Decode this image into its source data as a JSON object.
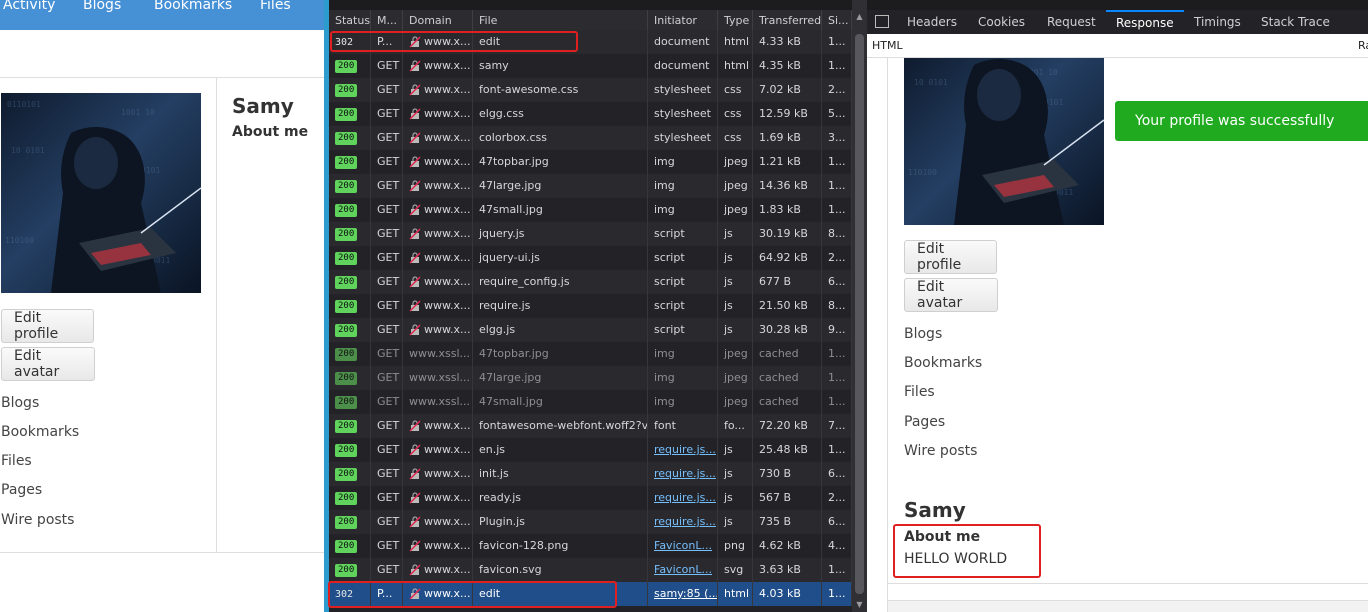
{
  "site": {
    "nav": [
      "Activity",
      "Blogs",
      "Bookmarks",
      "Files"
    ],
    "profile_name": "Samy",
    "about_label": "About me",
    "buttons": {
      "edit_profile": "Edit profile",
      "edit_avatar": "Edit avatar"
    },
    "links": [
      "Blogs",
      "Bookmarks",
      "Files",
      "Pages",
      "Wire posts"
    ]
  },
  "network": {
    "columns": [
      "Status",
      "M...",
      "Domain",
      "File",
      "Initiator",
      "Type",
      "Transferred",
      "Si..."
    ],
    "rows": [
      {
        "status": "302",
        "method": "P...",
        "domain": "www.x...",
        "file": "edit",
        "initiator": "document",
        "type": "html",
        "transferred": "4.33 kB",
        "size": "1...",
        "secure": true
      },
      {
        "status": "200",
        "method": "GET",
        "domain": "www.x...",
        "file": "samy",
        "initiator": "document",
        "type": "html",
        "transferred": "4.35 kB",
        "size": "1...",
        "secure": true
      },
      {
        "status": "200",
        "method": "GET",
        "domain": "www.x...",
        "file": "font-awesome.css",
        "initiator": "stylesheet",
        "type": "css",
        "transferred": "7.02 kB",
        "size": "2...",
        "secure": true
      },
      {
        "status": "200",
        "method": "GET",
        "domain": "www.x...",
        "file": "elgg.css",
        "initiator": "stylesheet",
        "type": "css",
        "transferred": "12.59 kB",
        "size": "5...",
        "secure": true
      },
      {
        "status": "200",
        "method": "GET",
        "domain": "www.x...",
        "file": "colorbox.css",
        "initiator": "stylesheet",
        "type": "css",
        "transferred": "1.69 kB",
        "size": "3...",
        "secure": true
      },
      {
        "status": "200",
        "method": "GET",
        "domain": "www.x...",
        "file": "47topbar.jpg",
        "initiator": "img",
        "type": "jpeg",
        "transferred": "1.21 kB",
        "size": "1...",
        "secure": true
      },
      {
        "status": "200",
        "method": "GET",
        "domain": "www.x...",
        "file": "47large.jpg",
        "initiator": "img",
        "type": "jpeg",
        "transferred": "14.36 kB",
        "size": "1...",
        "secure": true
      },
      {
        "status": "200",
        "method": "GET",
        "domain": "www.x...",
        "file": "47small.jpg",
        "initiator": "img",
        "type": "jpeg",
        "transferred": "1.83 kB",
        "size": "1...",
        "secure": true
      },
      {
        "status": "200",
        "method": "GET",
        "domain": "www.x...",
        "file": "jquery.js",
        "initiator": "script",
        "type": "js",
        "transferred": "30.19 kB",
        "size": "8...",
        "secure": true
      },
      {
        "status": "200",
        "method": "GET",
        "domain": "www.x...",
        "file": "jquery-ui.js",
        "initiator": "script",
        "type": "js",
        "transferred": "64.92 kB",
        "size": "2...",
        "secure": true
      },
      {
        "status": "200",
        "method": "GET",
        "domain": "www.x...",
        "file": "require_config.js",
        "initiator": "script",
        "type": "js",
        "transferred": "677 B",
        "size": "6...",
        "secure": true
      },
      {
        "status": "200",
        "method": "GET",
        "domain": "www.x...",
        "file": "require.js",
        "initiator": "script",
        "type": "js",
        "transferred": "21.50 kB",
        "size": "8...",
        "secure": true
      },
      {
        "status": "200",
        "method": "GET",
        "domain": "www.x...",
        "file": "elgg.js",
        "initiator": "script",
        "type": "js",
        "transferred": "30.28 kB",
        "size": "9...",
        "secure": true
      },
      {
        "status": "200",
        "method": "GET",
        "domain": "www.xssl...",
        "file": "47topbar.jpg",
        "initiator": "img",
        "type": "jpeg",
        "transferred": "cached",
        "size": "1...",
        "secure": false,
        "cached": true
      },
      {
        "status": "200",
        "method": "GET",
        "domain": "www.xssl...",
        "file": "47large.jpg",
        "initiator": "img",
        "type": "jpeg",
        "transferred": "cached",
        "size": "1...",
        "secure": false,
        "cached": true
      },
      {
        "status": "200",
        "method": "GET",
        "domain": "www.xssl...",
        "file": "47small.jpg",
        "initiator": "img",
        "type": "jpeg",
        "transferred": "cached",
        "size": "1...",
        "secure": false,
        "cached": true
      },
      {
        "status": "200",
        "method": "GET",
        "domain": "www.x...",
        "file": "fontawesome-webfont.woff2?v=",
        "initiator": "font",
        "type": "fo...",
        "transferred": "72.20 kB",
        "size": "7...",
        "secure": true
      },
      {
        "status": "200",
        "method": "GET",
        "domain": "www.x...",
        "file": "en.js",
        "initiator": "require.js...",
        "type": "js",
        "transferred": "25.48 kB",
        "size": "1...",
        "secure": true,
        "initiator_link": true
      },
      {
        "status": "200",
        "method": "GET",
        "domain": "www.x...",
        "file": "init.js",
        "initiator": "require.js...",
        "type": "js",
        "transferred": "730 B",
        "size": "6...",
        "secure": true,
        "initiator_link": true
      },
      {
        "status": "200",
        "method": "GET",
        "domain": "www.x...",
        "file": "ready.js",
        "initiator": "require.js...",
        "type": "js",
        "transferred": "567 B",
        "size": "2...",
        "secure": true,
        "initiator_link": true
      },
      {
        "status": "200",
        "method": "GET",
        "domain": "www.x...",
        "file": "Plugin.js",
        "initiator": "require.js...",
        "type": "js",
        "transferred": "735 B",
        "size": "6...",
        "secure": true,
        "initiator_link": true
      },
      {
        "status": "200",
        "method": "GET",
        "domain": "www.x...",
        "file": "favicon-128.png",
        "initiator": "FaviconL...",
        "type": "png",
        "transferred": "4.62 kB",
        "size": "4...",
        "secure": true,
        "initiator_link": true
      },
      {
        "status": "200",
        "method": "GET",
        "domain": "www.x...",
        "file": "favicon.svg",
        "initiator": "FaviconL...",
        "type": "svg",
        "transferred": "3.63 kB",
        "size": "1...",
        "secure": true,
        "initiator_link": true
      },
      {
        "status": "302",
        "method": "P...",
        "domain": "www.x...",
        "file": "edit",
        "initiator": "samy:85 (...",
        "type": "html",
        "transferred": "4.03 kB",
        "size": "1...",
        "secure": true,
        "initiator_link": true,
        "selected": true
      }
    ]
  },
  "response": {
    "tabs": [
      "Headers",
      "Cookies",
      "Request",
      "Response",
      "Timings",
      "Stack Trace"
    ],
    "active_tab": "Response",
    "sub_label": "HTML",
    "sub_right": "Ra",
    "success_message": "Your profile was successfully saved.",
    "buttons": {
      "edit_profile": "Edit profile",
      "edit_avatar": "Edit avatar"
    },
    "links": [
      "Blogs",
      "Bookmarks",
      "Files",
      "Pages",
      "Wire posts"
    ],
    "profile_name": "Samy",
    "about_label": "About me",
    "about_text": "HELLO WORLD"
  },
  "colors": {
    "nav_bar": "#4690d6",
    "highlight": "#e02020",
    "success": "#1faa1f",
    "selected_row": "#204e8a",
    "status_ok": "#5fd35c"
  }
}
